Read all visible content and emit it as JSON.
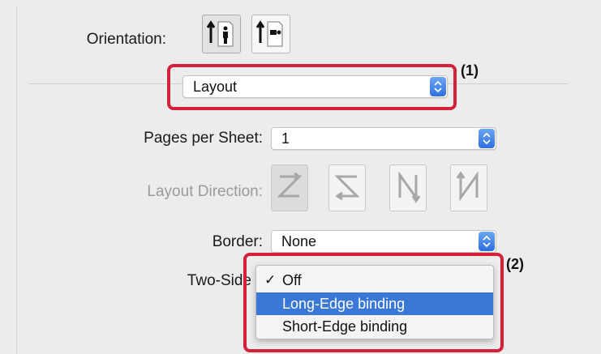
{
  "orientation": {
    "label": "Orientation:"
  },
  "section_select": {
    "value": "Layout",
    "callout": "(1)"
  },
  "pages_per_sheet": {
    "label": "Pages per Sheet:",
    "value": "1"
  },
  "layout_direction": {
    "label": "Layout Direction:"
  },
  "border": {
    "label": "Border:",
    "value": "None"
  },
  "two_sided": {
    "label": "Two-Side",
    "callout": "(2)",
    "options": [
      {
        "label": "Off",
        "checked": true
      },
      {
        "label": "Long-Edge binding",
        "highlighted": true
      },
      {
        "label": "Short-Edge binding"
      }
    ]
  },
  "colors": {
    "callout": "#d4203a",
    "highlight": "#3a78d8",
    "stepper": "#2e6fe0"
  }
}
